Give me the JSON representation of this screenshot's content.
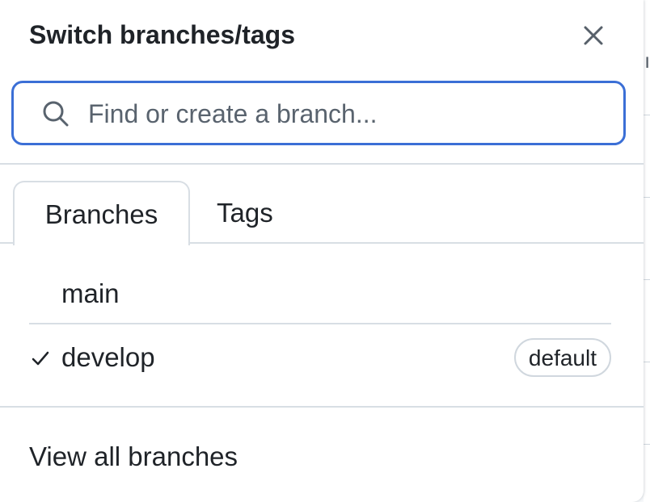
{
  "dialog": {
    "title": "Switch branches/tags",
    "close_icon": "close-icon"
  },
  "search": {
    "placeholder": "Find or create a branch...",
    "value": "",
    "icon": "search-icon",
    "focus_color": "#3b6fd6"
  },
  "tabs": [
    {
      "label": "Branches",
      "active": true
    },
    {
      "label": "Tags",
      "active": false
    }
  ],
  "branches": [
    {
      "name": "main",
      "selected": false,
      "badge": ""
    },
    {
      "name": "develop",
      "selected": true,
      "badge": "default"
    }
  ],
  "footer": {
    "view_all_label": "View all branches"
  }
}
